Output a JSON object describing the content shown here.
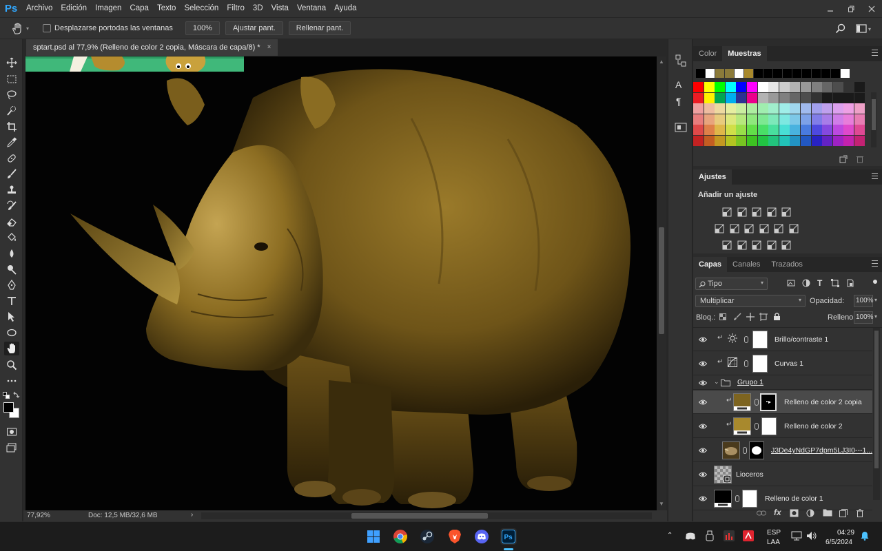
{
  "app": {
    "logo": "Ps",
    "accent": "#31a8ff"
  },
  "menu": [
    "Archivo",
    "Edición",
    "Imagen",
    "Capa",
    "Texto",
    "Selección",
    "Filtro",
    "3D",
    "Vista",
    "Ventana",
    "Ayuda"
  ],
  "options_bar": {
    "scroll_all_label": "Desplazarse portodas las ventanas",
    "zoom_value": "100%",
    "fit_screen": "Ajustar pant.",
    "fill_screen": "Rellenar pant."
  },
  "document": {
    "tab_title": "sptart.psd al 77,9% (Relleno de color 2 copia, Máscara de capa/8) *",
    "close": "×"
  },
  "status": {
    "zoom": "77,92%",
    "doc_size": "Doc: 12,5 MB/32,6 MB",
    "arrow": "›"
  },
  "swatches_panel": {
    "tabs": [
      "Color",
      "Muestras"
    ],
    "active_tab": "Muestras",
    "recent": [
      "#000000",
      "#ffffff",
      "#8b7a3a",
      "#8b7a3a",
      "#ffffff",
      "#a8892d",
      "#000000",
      "#000000",
      "#000000",
      "#000000",
      "#000000",
      "#000000",
      "#000000",
      "#000000",
      "#000000",
      "#ffffff"
    ]
  },
  "adjustments_panel": {
    "title": "Ajustes",
    "subtitle": "Añadir un ajuste"
  },
  "layers_panel": {
    "tabs": [
      "Capas",
      "Canales",
      "Trazados"
    ],
    "active_tab": "Capas",
    "filter_label": "Tipo",
    "blend_mode": "Multiplicar",
    "opacity_label": "Opacidad:",
    "opacity_value": "100%",
    "lock_label": "Bloq.:",
    "fill_label": "Relleno:",
    "fill_value": "100%",
    "layers": [
      {
        "name": "Brillo/contraste 1",
        "kind": "adjustment",
        "icon": "brightness-icon"
      },
      {
        "name": "Curvas 1",
        "kind": "adjustment",
        "icon": "curves-icon"
      },
      {
        "name": "Grupo 1",
        "kind": "group"
      },
      {
        "name": "Relleno de color 2 copia",
        "kind": "fill",
        "color": "#7d6420",
        "selected": true
      },
      {
        "name": "Relleno de color 2",
        "kind": "fill",
        "color": "#a8892d"
      },
      {
        "name": "J3De4yNdGP7dpm5LJ3I0---1...",
        "kind": "image"
      },
      {
        "name": "Lioceros",
        "kind": "smart"
      },
      {
        "name": "Relleno de color 1",
        "kind": "fill",
        "color": "#000000"
      }
    ]
  },
  "taskbar": {
    "lang": "ESP",
    "lang2": "LAA",
    "time": "04:29",
    "date": "6/5/2024"
  }
}
